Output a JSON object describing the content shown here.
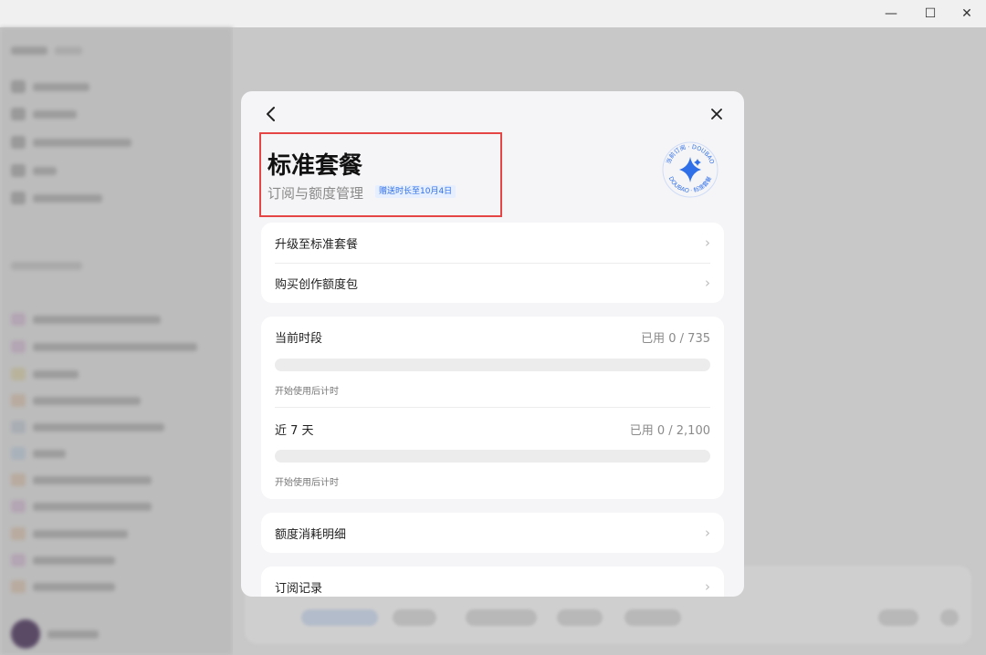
{
  "window": {
    "minimize_glyph": "—",
    "maximize_glyph": "☐",
    "close_glyph": "✕"
  },
  "modal": {
    "title": "标准套餐",
    "subtitle": "订阅与额度管理",
    "badge": "赠送时长至10月4日",
    "seal": {
      "text_top": "当前订阅 · DOUBAO",
      "text_bottom": "DOUBAO · 标准套餐",
      "icon": "sparkle-icon",
      "color": "#2f6fe8"
    },
    "actions": [
      {
        "label": "升级至标准套餐"
      },
      {
        "label": "购买创作额度包"
      }
    ],
    "usage": [
      {
        "label": "当前时段",
        "value": "已用 0 / 735",
        "used_fraction": 0,
        "note": "开始使用后计时"
      },
      {
        "label": "近 7 天",
        "value": "已用 0 / 2,100",
        "used_fraction": 0,
        "note": "开始使用后计时"
      }
    ],
    "links": [
      {
        "label": "额度消耗明细"
      },
      {
        "label": "订阅记录"
      }
    ]
  },
  "colors": {
    "accent": "#2f6fe8",
    "highlight": "#e64545"
  }
}
